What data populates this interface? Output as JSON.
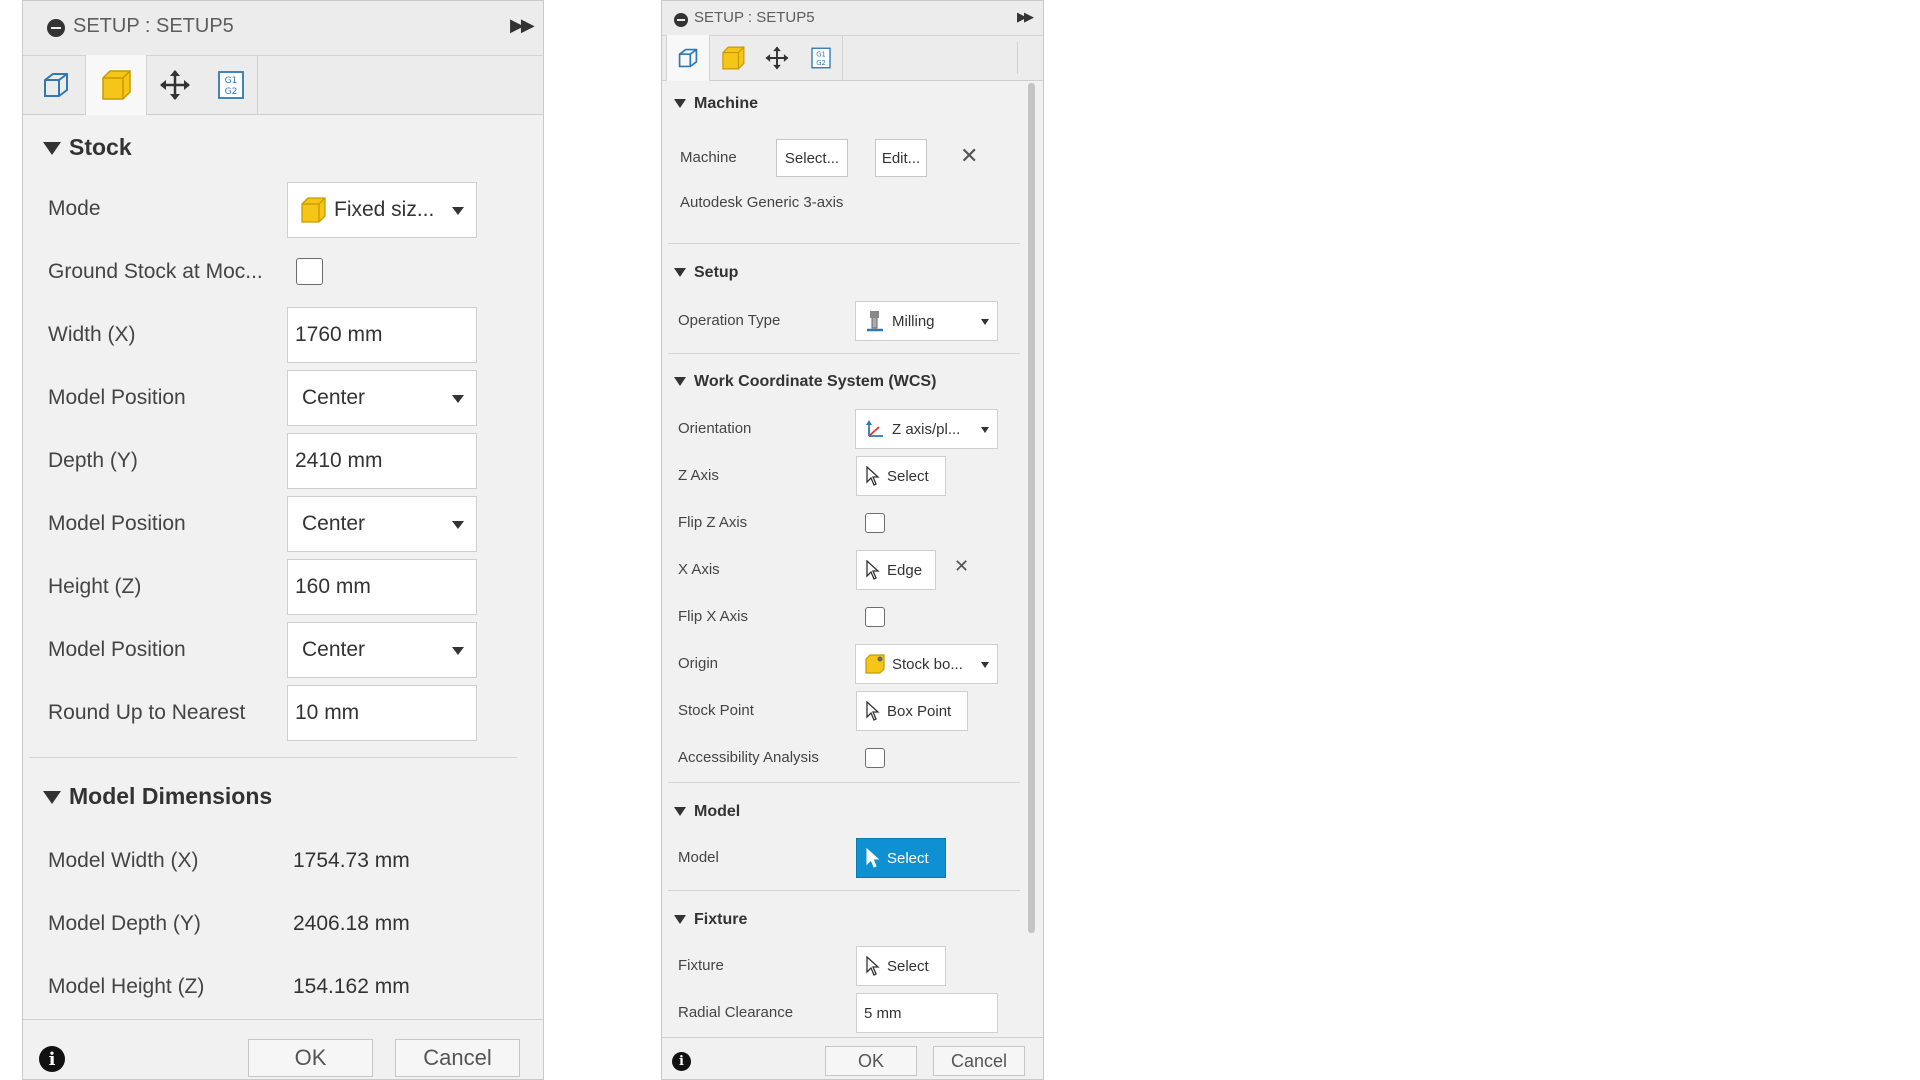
{
  "panel_left": {
    "title": "SETUP : SETUP5",
    "tabs": [
      "setup-tab",
      "stock-tab",
      "post-process-tab",
      "gcode-tab"
    ],
    "stock": {
      "header": "Stock",
      "mode_label": "Mode",
      "mode_value": "Fixed siz...",
      "ground_label": "Ground Stock at Moc...",
      "width_label": "Width (X)",
      "width_value": "1760 mm",
      "model_pos_label": "Model Position",
      "model_pos_1": "Center",
      "depth_label": "Depth (Y)",
      "depth_value": "2410 mm",
      "model_pos_2": "Center",
      "height_label": "Height (Z)",
      "height_value": "160 mm",
      "model_pos_3": "Center",
      "round_label": "Round Up to Nearest",
      "round_value": "10 mm"
    },
    "dims": {
      "header": "Model Dimensions",
      "width_label": "Model Width (X)",
      "width_value": "1754.73 mm",
      "depth_label": "Model Depth (Y)",
      "depth_value": "2406.18 mm",
      "height_label": "Model Height (Z)",
      "height_value": "154.162 mm"
    },
    "ok": "OK",
    "cancel": "Cancel"
  },
  "panel_right": {
    "title": "SETUP : SETUP5",
    "machine": {
      "header": "Machine",
      "label": "Machine",
      "select": "Select...",
      "edit": "Edit...",
      "name": "Autodesk Generic 3-axis"
    },
    "setup": {
      "header": "Setup",
      "op_label": "Operation Type",
      "op_value": "Milling"
    },
    "wcs": {
      "header": "Work Coordinate System (WCS)",
      "orientation_label": "Orientation",
      "orientation_value": "Z axis/pl...",
      "zaxis_label": "Z Axis",
      "zaxis_value": "Select",
      "flipz_label": "Flip Z Axis",
      "xaxis_label": "X Axis",
      "xaxis_value": "Edge",
      "flipx_label": "Flip X Axis",
      "origin_label": "Origin",
      "origin_value": "Stock bo...",
      "stockpoint_label": "Stock Point",
      "stockpoint_value": "Box Point",
      "access_label": "Accessibility Analysis"
    },
    "model": {
      "header": "Model",
      "label": "Model",
      "value": "Select"
    },
    "fixture": {
      "header": "Fixture",
      "label": "Fixture",
      "value": "Select",
      "radial_label": "Radial Clearance",
      "radial_value": "5 mm"
    },
    "ok": "OK",
    "cancel": "Cancel"
  },
  "colors": {
    "accent_blue": "#0f90d2",
    "stock_yellow": "#f5c518",
    "panel_bg": "#f1f1f1"
  }
}
